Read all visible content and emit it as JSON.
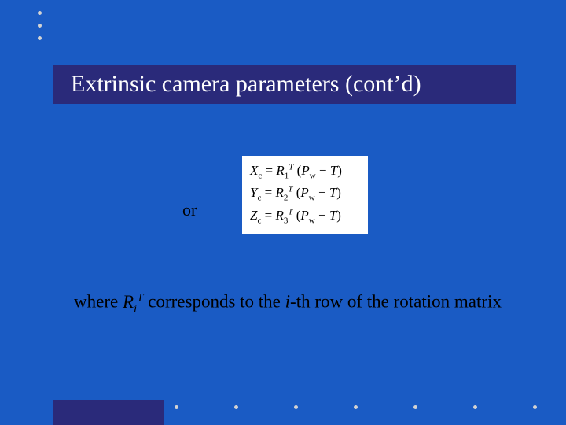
{
  "title": "Extrinsic camera parameters (cont’d)",
  "or_label": "or",
  "equations": {
    "line1_html": "<i>X<sub>c</sub></i> = <i>R</i><sub>1</sub><sup>T</sup> (<i>P<sub>w</sub></i> &minus; <i>T</i>)",
    "line2_html": "<i>Y<sub>c</sub></i> = <i>R</i><sub>2</sub><sup>T</sup> (<i>P<sub>w</sub></i> &minus; <i>T</i>)",
    "line3_html": "<i>Z<sub>c</sub></i> = <i>R</i><sub>3</sub><sup>T</sup> (<i>P<sub>w</sub></i> &minus; <i>T</i>)"
  },
  "where_html": "where <span class=\"ital\">R<sub>i</sub><sup>T</sup></span> corresponds to the <span class=\"ital\">i</span>-th row of the rotation matrix"
}
